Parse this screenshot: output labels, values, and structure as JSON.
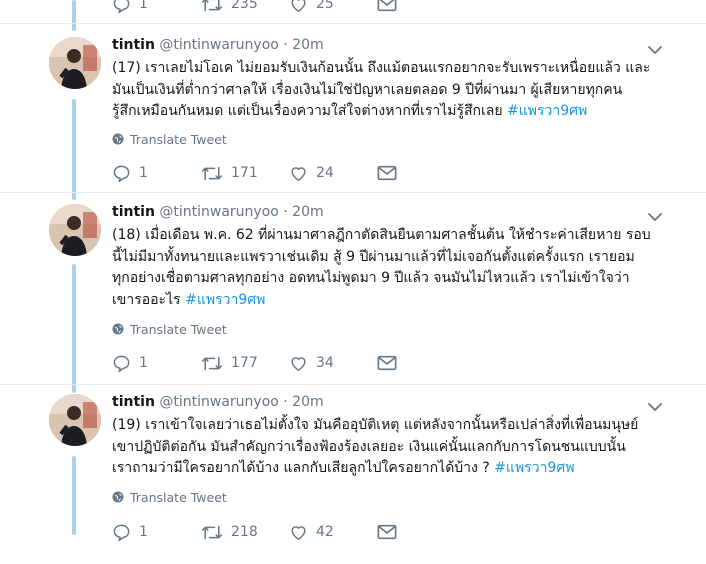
{
  "top_actions": {
    "replies": "1",
    "retweets": "235",
    "likes": "25"
  },
  "translate_label": "Translate Tweet",
  "hashtag": "#แพรวา9ศพ",
  "tweets": [
    {
      "name": "tintin",
      "handle": "@tintinwarunyoo",
      "time": "· 20m",
      "lines": [
        "(17) เราเลยไม่โอเค ไม่ยอมรับเงินก้อนนั้น ถึงแม้ตอนแรกอยากจะรับเพราะเหนื่อยแล้ว และ",
        "มันเป็นเงินที่ต่ำกว่าศาลให้ เรื่องเงินไม่ใช่ปัญหาเลยตลอด 9 ปีที่ผ่านมา ผู้เสียหายทุกคน",
        "รู้สึกเหมือนกันหมด แต่เป็นเรื่องความใส่ใจต่างหากที่เราไม่รู้สึกเลย "
      ],
      "replies": "1",
      "retweets": "171",
      "likes": "24"
    },
    {
      "name": "tintin",
      "handle": "@tintinwarunyoo",
      "time": "· 20m",
      "lines": [
        "(18) เมื่อเดือน พ.ค. 62 ที่ผ่านมาศาลฎีกาตัดสินยืนตามศาลชั้นต้น ให้ชำระค่าเสียหาย รอบ",
        "นี้ไม่มีมาทั้งทนายและแพรวาเช่นเดิม สู้ 9 ปีผ่านมาแล้วที่ไม่เจอกันตั้งแต่ครั้งแรก เรายอม",
        "ทุกอย่างเชื่อตามศาลทุกอย่าง อดทนไม่พูดมา 9 ปีแล้ว จนมันไม่ไหวแล้ว เราไม่เข้าใจว่า",
        "เขารออะไร "
      ],
      "replies": "1",
      "retweets": "177",
      "likes": "34"
    },
    {
      "name": "tintin",
      "handle": "@tintinwarunyoo",
      "time": "· 20m",
      "lines": [
        "(19) เราเข้าใจเลยว่าเธอไม่ตั้งใจ มันคืออุบัติเหตุ แต่หลังจากนั้นหรือเปล่าสิ่งที่เพื่อนมนุษย์",
        "เขาปฏิบัติต่อกัน มันสำคัญกว่าเรื่องฟ้องร้องเลยอะ เงินแค่นั้นแลกกับการโดนชนแบบนั้น",
        "เราถามว่ามีใครอยากได้บ้าง แลกกับเสียลูกไปใครอยากได้บ้าง ? "
      ],
      "replies": "1",
      "retweets": "218",
      "likes": "42"
    }
  ]
}
